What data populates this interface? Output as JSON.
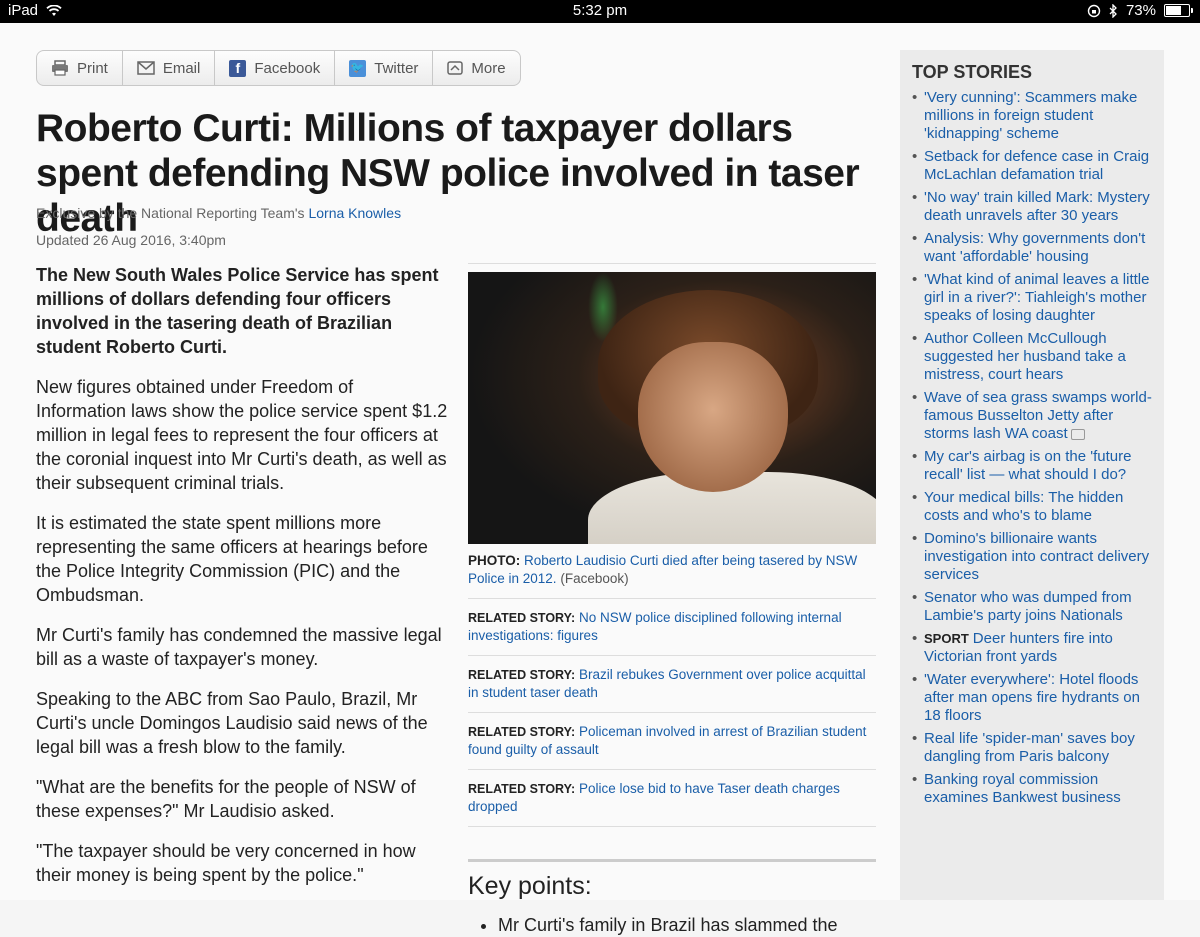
{
  "status_bar": {
    "device": "iPad",
    "time": "5:32 pm",
    "battery": "73%",
    "battery_level": 0.73
  },
  "share_bar": {
    "print": "Print",
    "email": "Email",
    "facebook": "Facebook",
    "twitter": "Twitter",
    "more": "More"
  },
  "article": {
    "headline": "Roberto Curti: Millions of taxpayer dollars spent defending NSW police involved in taser death",
    "byline_prefix": "Exclusive by the National Reporting Team's",
    "author": "Lorna Knowles",
    "updated": "Updated 26 Aug 2016, 3:40pm",
    "paragraphs": [
      "The New South Wales Police Service has spent millions of dollars defending four officers involved in the tasering death of Brazilian student Roberto Curti.",
      "New figures obtained under Freedom of Information laws show the police service spent $1.2 million in legal fees to represent the four officers at the coronial inquest into Mr Curti's death, as well as their subsequent criminal trials.",
      "It is estimated the state spent millions more representing the same officers at hearings before the Police Integrity Commission (PIC) and the Ombudsman.",
      "Mr Curti's family has condemned the massive legal bill as a waste of taxpayer's money.",
      "Speaking to the ABC from Sao Paulo, Brazil, Mr Curti's uncle Domingos Laudisio said news of the legal bill was a fresh blow to the family.",
      "\"What are the benefits for the people of NSW of these expenses?\" Mr Laudisio asked.",
      "\"The taxpayer should be very concerned in how their money is being spent by the police.\""
    ]
  },
  "figure": {
    "caption_label": "PHOTO:",
    "caption_link": "Roberto Laudisio Curti died after being tasered by NSW Police in 2012.",
    "caption_credit": "(Facebook)"
  },
  "related": {
    "label": "RELATED STORY:",
    "items": [
      "No NSW police disciplined following internal investigations: figures",
      "Brazil rebukes Government over police acquittal in student taser death",
      "Policeman involved in arrest of Brazilian student found guilty of assault",
      "Police lose bid to have Taser death charges dropped"
    ]
  },
  "key_points": {
    "title": "Key points:",
    "items": [
      "Mr Curti's family in Brazil has slammed the"
    ]
  },
  "sidebar": {
    "title": "TOP STORIES",
    "sport_tag": "SPORT",
    "items": [
      "'Very cunning': Scammers make millions in foreign student 'kidnapping' scheme",
      "Setback for defence case in Craig McLachlan defamation trial",
      "'No way' train killed Mark: Mystery death unravels after 30 years",
      "Analysis: Why governments don't want 'affordable' housing",
      "'What kind of animal leaves a little girl in a river?': Tiahleigh's mother speaks of losing daughter",
      "Author Colleen McCullough suggested her husband take a mistress, court hears",
      "Wave of sea grass swamps world-famous Busselton Jetty after storms lash WA coast",
      "My car's airbag is on the 'future recall' list — what should I do?",
      "Your medical bills: The hidden costs and who's to blame",
      "Domino's billionaire wants investigation into contract delivery services",
      "Senator who was dumped from Lambie's party joins Nationals",
      "Deer hunters fire into Victorian front yards",
      "'Water everywhere': Hotel floods after man opens fire hydrants on 18 floors",
      "Real life 'spider-man' saves boy dangling from Paris balcony",
      "Banking royal commission examines Bankwest business"
    ]
  }
}
